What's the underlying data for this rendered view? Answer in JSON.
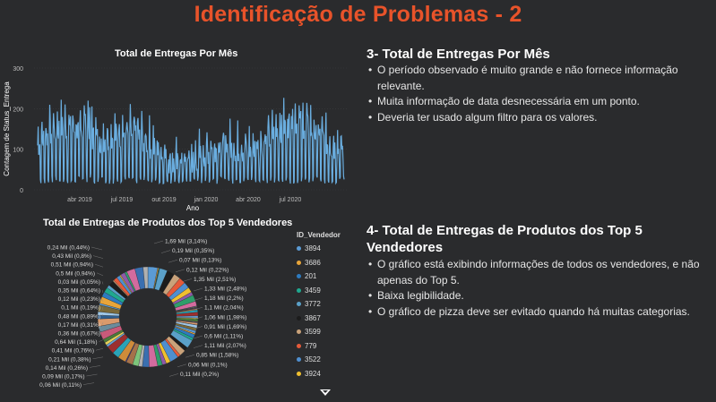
{
  "slide_title": "Identificação de Problemas - 2",
  "chart_data": [
    {
      "type": "line",
      "title": "Total de Entregas Por Mês",
      "xlabel": "Ano",
      "ylabel": "Contagem de Status_Entrega",
      "ylim": [
        0,
        300
      ],
      "y_ticks": [
        "0",
        "100",
        "200",
        "300"
      ],
      "x_ticks": [
        "abr 2019",
        "jul 2019",
        "out 2019",
        "jan 2020",
        "abr 2020",
        "jul 2020"
      ],
      "series_color": "#6aaee0"
    },
    {
      "type": "pie",
      "title": "Total de Entregas de Produtos dos Top 5 Vendedores",
      "legend_title": "ID_Vendedor",
      "legend": [
        {
          "label": "3894",
          "color": "#5b9bd5"
        },
        {
          "label": "3686",
          "color": "#e8a53a"
        },
        {
          "label": "201",
          "color": "#2e7bbf"
        },
        {
          "label": "3459",
          "color": "#1fa88f"
        },
        {
          "label": "3772",
          "color": "#5aa0c8"
        },
        {
          "label": "3867",
          "color": "#1c1c1c"
        },
        {
          "label": "3599",
          "color": "#c9a27a"
        },
        {
          "label": "779",
          "color": "#e55a3a"
        },
        {
          "label": "3522",
          "color": "#4f8fd0"
        },
        {
          "label": "3924",
          "color": "#f0c030"
        }
      ],
      "data_labels_left": [
        "0,24 Mil (0,44%)",
        "0,43 Mil (0,8%)",
        "0,51 Mil (0,94%)",
        "0,5 Mil (0,94%)",
        "0,03 Mil (0,05%)",
        "0,35 Mil (0,64%)",
        "0,12 Mil (0,23%)",
        "0,1 Mil (0,19%)",
        "0,48 Mil (0,89%)",
        "0,17 Mil (0,31%)",
        "0,36 Mil (0,67%)",
        "0,64 Mil (1,18%)",
        "0,41 Mil (0,76%)",
        "0,21 Mil (0,38%)",
        "0,14 Mil (0,26%)",
        "0,09 Mil (0,17%)",
        "0,06 Mil (0,11%)"
      ],
      "data_labels_right": [
        "1,69 Mil (3,14%)",
        "0,19 Mil (0,35%)",
        "0,07 Mil (0,13%)",
        "0,12 Mil (0,22%)",
        "1,35 Mil (2,51%)",
        "1,33 Mil (2,48%)",
        "1,18 Mil (2,2%)",
        "1,1 Mil (2,04%)",
        "1,06 Mil (1,98%)",
        "0,91 Mil (1,69%)",
        "0,6 Mil (1,11%)",
        "1,11 Mil (2,07%)",
        "0,85 Mil (1,58%)",
        "0,06 Mil (0,1%)",
        "0,11 Mil (0,2%)"
      ],
      "slice_percents": [
        3.14,
        0.35,
        0.13,
        0.22,
        2.51,
        2.48,
        2.2,
        2.04,
        1.98,
        1.69,
        1.11,
        2.07,
        1.58,
        0.1,
        0.2,
        0.11,
        0.17,
        0.26,
        0.38,
        0.76,
        1.18,
        0.67,
        0.31,
        0.89,
        0.19,
        0.23,
        0.64,
        0.05,
        0.94,
        0.94,
        0.8,
        0.44
      ]
    }
  ],
  "section3": {
    "heading": "3- Total de Entregas Por Mês",
    "bullets": [
      "O período observado é muito grande e não fornece informação relevante.",
      "Muita informação de data desnecessária em um ponto.",
      "Deveria ter usado algum filtro para os valores."
    ]
  },
  "section4": {
    "heading": "4- Total de Entregas de Produtos dos Top 5 Vendedores",
    "bullets": [
      "O gráfico está exibindo informações de todos os vendedores, e não apenas do Top 5.",
      "Baixa legibilidade.",
      "O gráfico de pizza deve ser evitado quando há muitas categorias."
    ]
  }
}
